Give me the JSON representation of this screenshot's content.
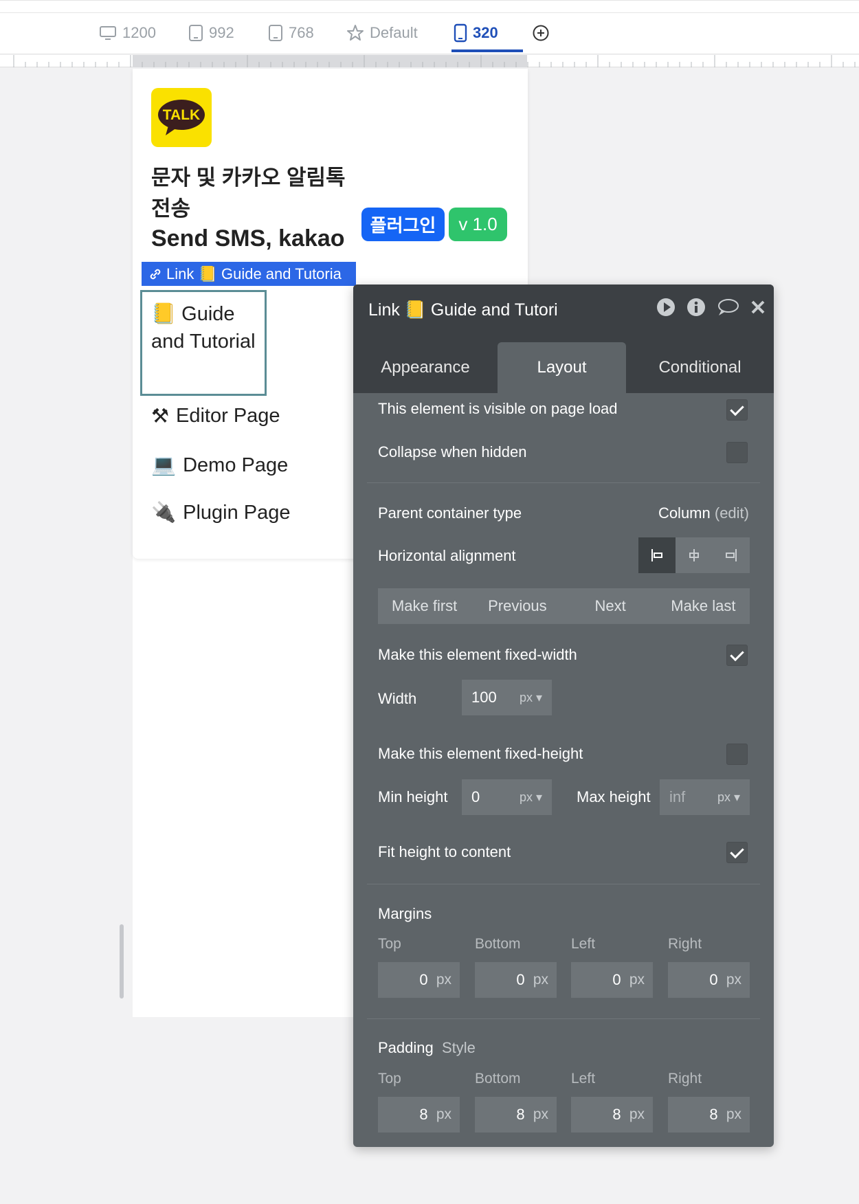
{
  "breakpoints": [
    {
      "label": "1200",
      "icon": "desktop-icon"
    },
    {
      "label": "992",
      "icon": "tablet-icon"
    },
    {
      "label": "768",
      "icon": "tablet-small-icon"
    },
    {
      "label": "Default",
      "icon": "star-icon"
    },
    {
      "label": "320",
      "icon": "mobile-icon",
      "active": true
    }
  ],
  "page": {
    "title_kr": "문자 및 카카오 알림톡 전송",
    "title_en": "Send SMS, kakao",
    "badge_plugin": "플러그인",
    "badge_version": "v 1.0",
    "logo_text": "TALK",
    "selected_label": "Link 📒 Guide and Tutoria",
    "selected_text": "📒 Guide and Tutorial",
    "links": [
      {
        "emoji": "⚒",
        "label": "Editor Page"
      },
      {
        "emoji": "💻",
        "label": "Demo Page"
      },
      {
        "emoji": "🔌",
        "label": "Plugin Page"
      }
    ]
  },
  "panel": {
    "title": "Link 📒 Guide and Tutori",
    "tabs": [
      "Appearance",
      "Layout",
      "Conditional"
    ],
    "active_tab": "Layout",
    "visible_on_load": "This element is visible on page load",
    "collapse_hidden": "Collapse when hidden",
    "parent_type_label": "Parent container type",
    "parent_type_value": "Column",
    "parent_type_edit": "(edit)",
    "h_align_label": "Horizontal alignment",
    "order_buttons": [
      "Make first",
      "Previous",
      "Next",
      "Make last"
    ],
    "fixed_width_label": "Make this element fixed-width",
    "width_label": "Width",
    "width_value": "100",
    "unit_px": "px",
    "fixed_height_label": "Make this element fixed-height",
    "min_height_label": "Min height",
    "min_height_value": "0",
    "max_height_label": "Max height",
    "max_height_placeholder": "inf",
    "fit_height_label": "Fit height to content",
    "margins_label": "Margins",
    "padding_label": "Padding",
    "padding_style": "Style",
    "sides": [
      "Top",
      "Bottom",
      "Left",
      "Right"
    ],
    "margins_values": [
      "0",
      "0",
      "0",
      "0"
    ],
    "padding_values": [
      "8",
      "8",
      "8",
      "8"
    ]
  }
}
